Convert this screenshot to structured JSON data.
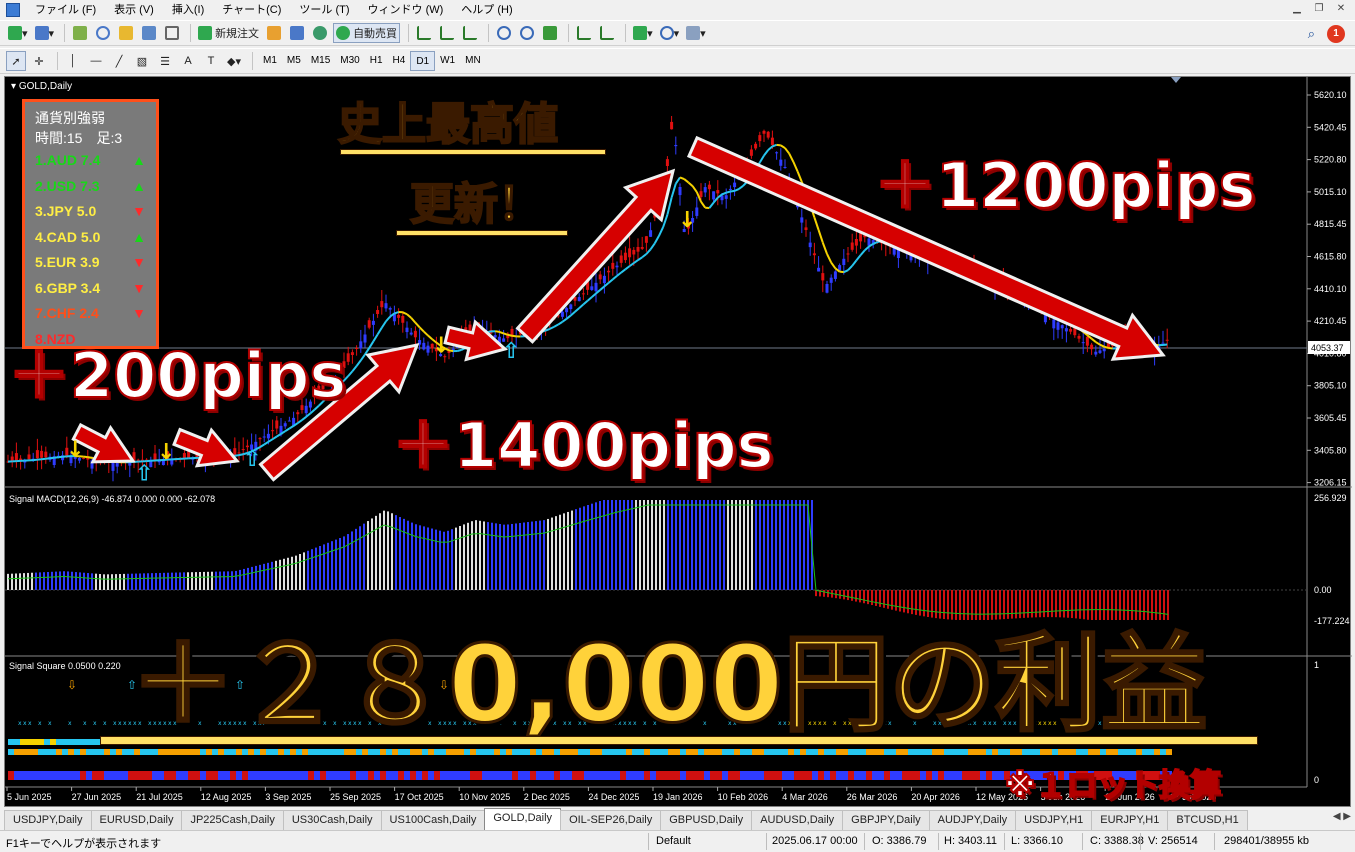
{
  "menu": [
    "ファイル (F)",
    "表示 (V)",
    "挿入(I)",
    "チャート(C)",
    "ツール (T)",
    "ウィンドウ (W)",
    "ヘルプ (H)"
  ],
  "toolbar": {
    "new_order": "新規注文",
    "auto_trade": "自動売買"
  },
  "timeframes": [
    "M1",
    "M5",
    "M15",
    "M30",
    "H1",
    "H4",
    "D1",
    "W1",
    "MN"
  ],
  "notification_count": "1",
  "chart": {
    "title": "GOLD,Daily",
    "current_price": "4053.37",
    "price_ticks": [
      "5620.10",
      "5420.45",
      "5220.80",
      "5015.10",
      "4815.45",
      "4615.80",
      "4410.10",
      "4210.45",
      "4010.80",
      "3805.10",
      "3605.45",
      "3405.80",
      "3206.15"
    ],
    "date_ticks": [
      "5 Jun 2025",
      "27 Jun 2025",
      "21 Jul 2025",
      "12 Aug 2025",
      "3 Sep 2025",
      "25 Sep 2025",
      "17 Oct 2025",
      "10 Nov 2025",
      "2 Dec 2025",
      "24 Dec 2025",
      "19 Jan 2026",
      "10 Feb 2026",
      "4 Mar 2026",
      "26 Mar 2026",
      "20 Apr 2026",
      "12 May 2026",
      "3 Jun 2026",
      "25 Jun 2026",
      "17 Jul 2026"
    ],
    "macd_label": "Signal MACD(12,26,9) -46.874 0.000 0.000 -62.078",
    "macd_ticks": [
      "256.929",
      "0.00",
      "-177.224"
    ],
    "square_label": "Signal Square 0.0500 0.220",
    "square_ticks": [
      "1",
      "0"
    ]
  },
  "strength": {
    "title": "通貨別強弱",
    "time_label": "時間:15　足:3",
    "rows": [
      {
        "label": "1.AUD 7.4",
        "dir": "▲",
        "color": "#18d818"
      },
      {
        "label": "2.USD 7.3",
        "dir": "▲",
        "color": "#18d818"
      },
      {
        "label": "3.JPY  5.0",
        "dir": "▼",
        "color": "#ffee44"
      },
      {
        "label": "4.CAD 5.0",
        "dir": "▲",
        "color": "#ffee44"
      },
      {
        "label": "5.EUR 3.9",
        "dir": "▼",
        "color": "#ffee44"
      },
      {
        "label": "6.GBP 3.4",
        "dir": "▼",
        "color": "#ffee44"
      },
      {
        "label": "7.CHF  2.4",
        "dir": "▼",
        "color": "#ff4f1a"
      },
      {
        "label": "8.NZD",
        "dir": "",
        "color": "#ff2a2a"
      }
    ]
  },
  "captions": {
    "record_1": "史上最高値",
    "record_2": "更新！",
    "pips_200": "＋200pips",
    "pips_1400": "＋1400pips",
    "pips_1200": "＋1200pips",
    "profit": "＋２８0,000円の利益",
    "note": "※１ロット換算"
  },
  "tabs": [
    "USDJPY,Daily",
    "EURUSD,Daily",
    "JP225Cash,Daily",
    "US30Cash,Daily",
    "US100Cash,Daily",
    "GOLD,Daily",
    "OIL-SEP26,Daily",
    "GBPUSD,Daily",
    "AUDUSD,Daily",
    "GBPJPY,Daily",
    "AUDJPY,Daily",
    "USDJPY,H1",
    "EURJPY,H1",
    "BTCUSD,H1"
  ],
  "active_tab": "GOLD,Daily",
  "status": {
    "help": "F1キーでヘルプが表示されます",
    "profile": "Default",
    "datetime": "2025.06.17 00:00",
    "open": "O: 3386.79",
    "high": "H: 3403.11",
    "low": "L: 3366.10",
    "close": "C: 3388.38",
    "volume": "V: 256514",
    "traffic": "298401/38955 kb"
  },
  "colors": {
    "bull": "#2f3cff",
    "bear": "#e01010",
    "signal_yellow": "#f5d300",
    "signal_cyan": "#27c6ef",
    "macd_signal": "#18c018"
  }
}
